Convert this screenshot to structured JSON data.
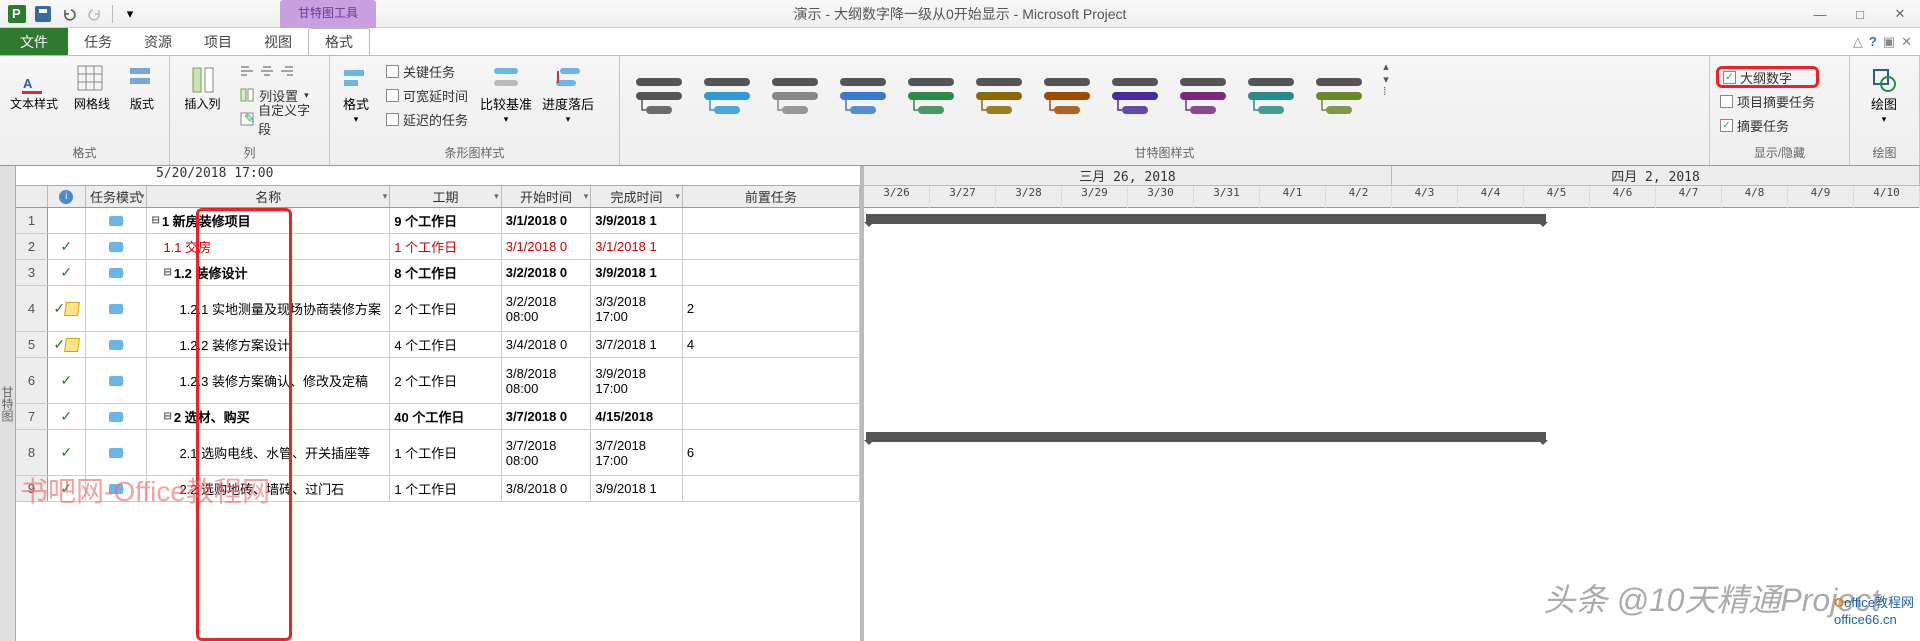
{
  "window": {
    "title": "演示 - 大纲数字降一级从0开始显示 - Microsoft Project",
    "contextual_tab": "甘特图工具"
  },
  "tabs": {
    "file": "文件",
    "items": [
      "任务",
      "资源",
      "项目",
      "视图",
      "格式"
    ],
    "active_index": 4
  },
  "ribbon": {
    "group_format": {
      "label": "格式",
      "text_styles": "文本样式",
      "gridlines": "网格线",
      "layout": "版式"
    },
    "group_columns": {
      "label": "列",
      "insert_col": "插入列",
      "col_settings": "列设置",
      "custom_fields": "自定义字段"
    },
    "group_barstyles": {
      "label": "条形图样式",
      "format_btn": "格式",
      "critical": "关键任务",
      "slack": "可宽延时间",
      "late": "延迟的任务",
      "baseline": "比较基准",
      "slippage": "进度落后"
    },
    "group_ganttstyles": {
      "label": "甘特图样式"
    },
    "group_showhide": {
      "label": "显示/隐藏",
      "outline_number": "大纲数字",
      "project_summary": "项目摘要任务",
      "summary_tasks": "摘要任务"
    },
    "group_drawing": {
      "label": "绘图",
      "btn": "绘图"
    }
  },
  "sheet": {
    "side_label": "甘特图",
    "date_header": "5/20/2018 17:00",
    "columns": [
      "",
      "",
      "任务模式",
      "名称",
      "工期",
      "开始时间",
      "完成时间",
      "前置任务"
    ],
    "rows": [
      {
        "n": "1",
        "ind": "",
        "mode": "auto",
        "name": "1 新房装修项目",
        "dur": "9 个工作日",
        "start": "3/1/2018 0",
        "end": "3/9/2018 1",
        "pred": "",
        "bold": true,
        "exp": true
      },
      {
        "n": "2",
        "ind": "check",
        "mode": "auto",
        "name": "1.1 交房",
        "dur": "1 个工作日",
        "start": "3/1/2018 0",
        "end": "3/1/2018 1",
        "pred": "",
        "red": true
      },
      {
        "n": "3",
        "ind": "check",
        "mode": "auto",
        "name": "1.2 装修设计",
        "dur": "8 个工作日",
        "start": "3/2/2018 0",
        "end": "3/9/2018 1",
        "pred": "",
        "bold": true,
        "exp": true
      },
      {
        "n": "4",
        "ind": "note-check",
        "mode": "auto",
        "name": "1.2.1 实地测量及现场协商装修方案",
        "dur": "2 个工作日",
        "start": "3/2/2018 08:00",
        "end": "3/3/2018 17:00",
        "pred": "2",
        "double": true
      },
      {
        "n": "5",
        "ind": "note-check",
        "mode": "auto",
        "name": "1.2.2 装修方案设计",
        "dur": "4 个工作日",
        "start": "3/4/2018 0",
        "end": "3/7/2018 1",
        "pred": "4"
      },
      {
        "n": "6",
        "ind": "check",
        "mode": "auto",
        "name": "1.2.3 装修方案确认、修改及定稿",
        "dur": "2 个工作日",
        "start": "3/8/2018 08:00",
        "end": "3/9/2018 17:00",
        "pred": "",
        "double": true
      },
      {
        "n": "7",
        "ind": "check",
        "mode": "auto",
        "name": "2 选材、购买",
        "dur": "40 个工作日",
        "start": "3/7/2018 0",
        "end": "4/15/2018",
        "pred": "",
        "bold": true,
        "exp": true
      },
      {
        "n": "8",
        "ind": "check",
        "mode": "auto",
        "name": "2.1 选购电线、水管、开关插座等",
        "dur": "1 个工作日",
        "start": "3/7/2018 08:00",
        "end": "3/7/2018 17:00",
        "pred": "6",
        "double": true
      },
      {
        "n": "9",
        "ind": "check",
        "mode": "auto",
        "name": "2.2 选购地砖、墙砖、过门石",
        "dur": "1 个工作日",
        "start": "3/8/2018 0",
        "end": "3/9/2018 1",
        "pred": ""
      }
    ]
  },
  "timeline": {
    "months": [
      "三月 26, 2018",
      "四月 2, 2018"
    ],
    "days": [
      "3/26",
      "3/27",
      "3/28",
      "3/29",
      "3/30",
      "3/31",
      "4/1",
      "4/2",
      "4/3",
      "4/4",
      "4/5",
      "4/6",
      "4/7",
      "4/8",
      "4/9",
      "4/10"
    ]
  },
  "watermarks": {
    "wm1": "书吧网-Office教程网",
    "wm2": "头条 @10天精通Project",
    "wm3a": "office教程网",
    "wm3b": "office66.cn"
  },
  "gantt_colors": [
    "#555",
    "#2e9ad6",
    "#888",
    "#3a7ad1",
    "#2a8a4a",
    "#8a6a00",
    "#a04a00",
    "#4a2aa0",
    "#7a2a7a",
    "#2a8a8a",
    "#6a8a2a"
  ]
}
